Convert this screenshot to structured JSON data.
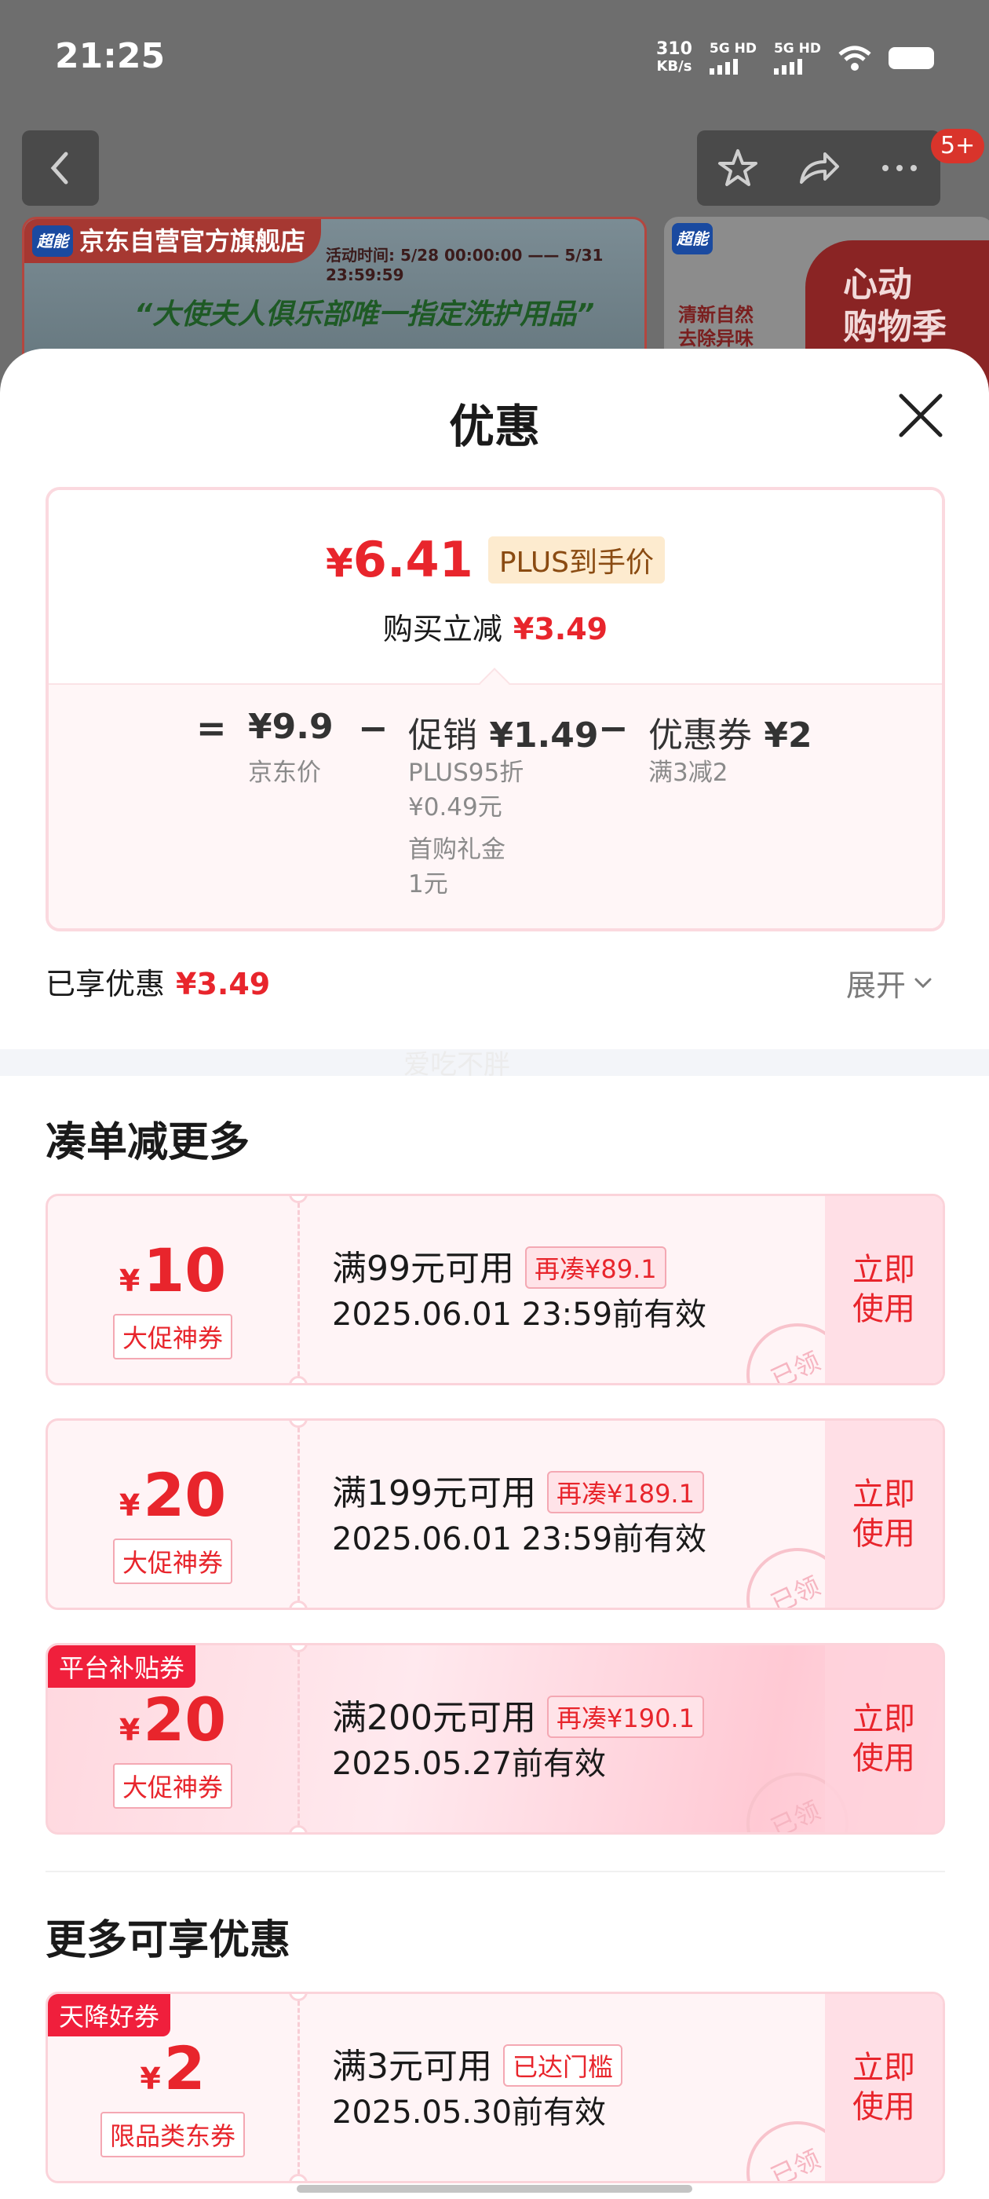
{
  "status_bar": {
    "time": "21:25",
    "net_speed_value": "310",
    "net_speed_unit": "KB/s",
    "sim1_label": "5G HD",
    "sim2_label": "5G HD",
    "icons": [
      "wifi-icon",
      "battery-icon"
    ]
  },
  "top_nav": {
    "notification_badge": "5+",
    "icons": [
      "back-icon",
      "star-icon",
      "share-icon",
      "more-icon"
    ]
  },
  "background_banner": {
    "store_logo": "超能",
    "store_name": "京东自营官方旗舰店",
    "activity_time": "活动时间: 5/28 00:00:00 —— 5/31 23:59:59",
    "slogan": "“大使夫人俱乐部唯一指定洗护用品”",
    "side_logo": "超能",
    "side_text_1": "清新自然",
    "side_text_2": "去除异味",
    "side_red_1": "心动",
    "side_red_2": "购物季"
  },
  "sheet": {
    "title": "优惠",
    "price_card": {
      "final_price_symbol": "¥",
      "final_price": "6.41",
      "plus_tag": "PLUS到手价",
      "cut_label": "购买立减",
      "cut_amount": "¥3.49",
      "equals": "=",
      "jd_price_value": "¥9.9",
      "jd_price_label": "京东价",
      "minus1": "−",
      "promo_label": "促销",
      "promo_value": "¥1.49",
      "promo_detail_1": "PLUS95折",
      "promo_detail_2": "¥0.49元",
      "promo_detail_3": "首购礼金",
      "promo_detail_4": "1元",
      "minus2": "−",
      "coupon_label": "优惠券",
      "coupon_value": "¥2",
      "coupon_detail": "满3减2"
    },
    "enjoyed_label": "已享优惠",
    "enjoyed_amount": "¥3.49",
    "expand_label": "展开",
    "watermark": "爱吃不胖",
    "section_more_order": "凑单减更多",
    "section_more_benefits": "更多可享优惠"
  },
  "coupons": [
    {
      "symbol": "¥",
      "amount": "10",
      "type": "大促神券",
      "tag": "",
      "condition": "满99元可用",
      "extra": "再凑¥89.1",
      "validity": "2025.06.01 23:59前有效",
      "use_label_1": "立即",
      "use_label_2": "使用",
      "stamp": "已领"
    },
    {
      "symbol": "¥",
      "amount": "20",
      "type": "大促神券",
      "tag": "",
      "condition": "满199元可用",
      "extra": "再凑¥189.1",
      "validity": "2025.06.01 23:59前有效",
      "use_label_1": "立即",
      "use_label_2": "使用",
      "stamp": "已领"
    },
    {
      "symbol": "¥",
      "amount": "20",
      "type": "大促神券",
      "tag": "平台补贴券",
      "condition": "满200元可用",
      "extra": "再凑¥190.1",
      "validity": "2025.05.27前有效",
      "use_label_1": "立即",
      "use_label_2": "使用",
      "stamp": "已领"
    },
    {
      "symbol": "¥",
      "amount": "2",
      "type": "限品类东券",
      "tag": "天降好券",
      "condition": "满3元可用",
      "extra": "已达门槛",
      "validity": "2025.05.30前有效",
      "use_label_1": "立即",
      "use_label_2": "使用",
      "stamp": "已领"
    }
  ],
  "colors": {
    "accent_red": "#e8252c",
    "plus_tag_bg": "#fdebcf",
    "coupon_border": "#fbd3da",
    "coupon_bg": "#fff4f6"
  }
}
